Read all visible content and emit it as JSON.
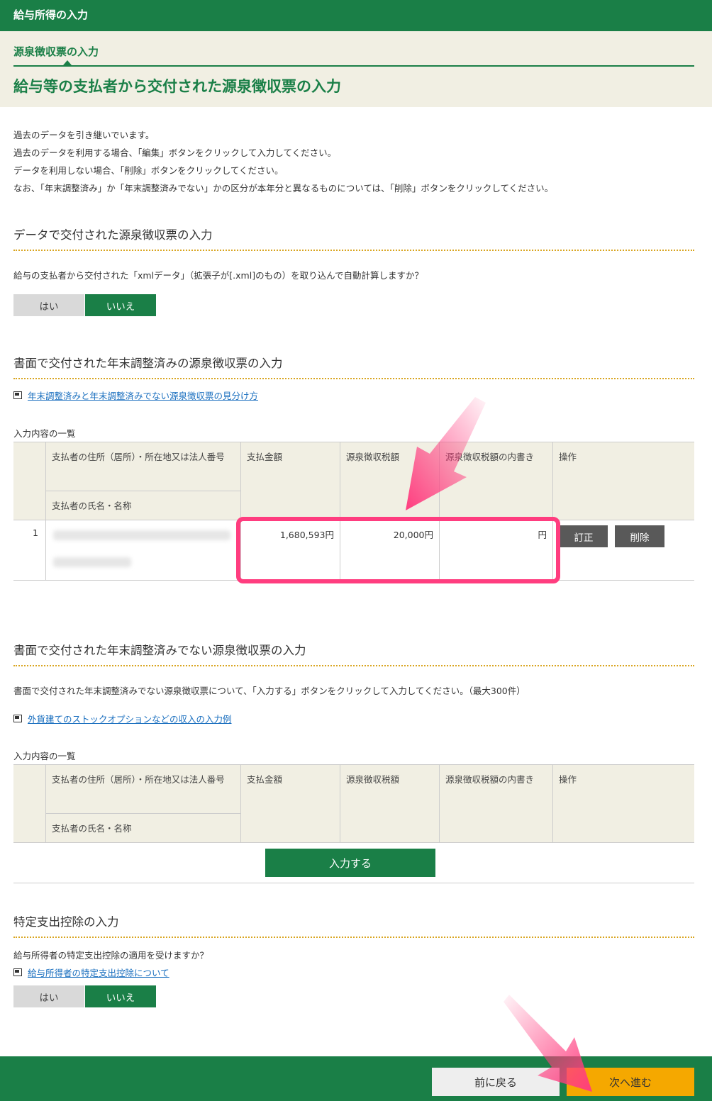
{
  "header": {
    "app_title": "給与所得の入力",
    "step_label": "源泉徴収票の入力",
    "page_title": "給与等の支払者から交付された源泉徴収票の入力"
  },
  "intro": {
    "lines": [
      "過去のデータを引き継いでいます。",
      "過去のデータを利用する場合、「編集」ボタンをクリックして入力してください。",
      "データを利用しない場合、「削除」ボタンをクリックしてください。",
      "なお、「年末調整済み」か「年末調整済みでない」かの区分が本年分と異なるものについては、「削除」ボタンをクリックしてください。"
    ]
  },
  "section_data": {
    "title": "データで交付された源泉徴収票の入力",
    "question": "給与の支払者から交付された「xmlデータ」（拡張子が[.xml]のもの）を取り込んで自動計算しますか？",
    "yes_label": "はい",
    "no_label": "いいえ",
    "selected": "いいえ"
  },
  "section_adjusted": {
    "title": "書面で交付された年末調整済みの源泉徴収票の入力",
    "link_text": "年末調整済みと年末調整済みでない源泉徴収票の見分け方",
    "list_label": "入力内容の一覧",
    "headers": {
      "payer_address": "支払者の住所（居所）・所在地又は法人番号",
      "payer_name": "支払者の氏名・名称",
      "payment": "支払金額",
      "withholding": "源泉徴収税額",
      "withholding_detail": "源泉徴収税額の内書き",
      "ops": "操作"
    },
    "rows": [
      {
        "no": "1",
        "payment": "1,680,593円",
        "withholding": "20,000円",
        "withholding_detail": "円",
        "edit_label": "訂正",
        "delete_label": "削除"
      }
    ]
  },
  "section_not_adjusted": {
    "title": "書面で交付された年末調整済みでない源泉徴収票の入力",
    "description": "書面で交付された年末調整済みでない源泉徴収票について、「入力する」ボタンをクリックして入力してください。（最大300件）",
    "link_text": "外貨建てのストックオプションなどの収入の入力例",
    "list_label": "入力内容の一覧",
    "headers": {
      "payer_address": "支払者の住所（居所）・所在地又は法人番号",
      "payer_name": "支払者の氏名・名称",
      "payment": "支払金額",
      "withholding": "源泉徴収税額",
      "withholding_detail": "源泉徴収税額の内書き",
      "ops": "操作"
    },
    "input_button": "入力する"
  },
  "section_special": {
    "title": "特定支出控除の入力",
    "question": "給与所得者の特定支出控除の適用を受けますか？",
    "link_text": "給与所得者の特定支出控除について",
    "yes_label": "はい",
    "no_label": "いいえ",
    "selected": "いいえ"
  },
  "footer": {
    "back_label": "前に戻る",
    "next_label": "次へ進む"
  },
  "colors": {
    "brand_green": "#1a7f47",
    "panel_beige": "#f1efe3",
    "next_orange": "#f5a800",
    "highlight_pink": "#ff3d7f"
  }
}
